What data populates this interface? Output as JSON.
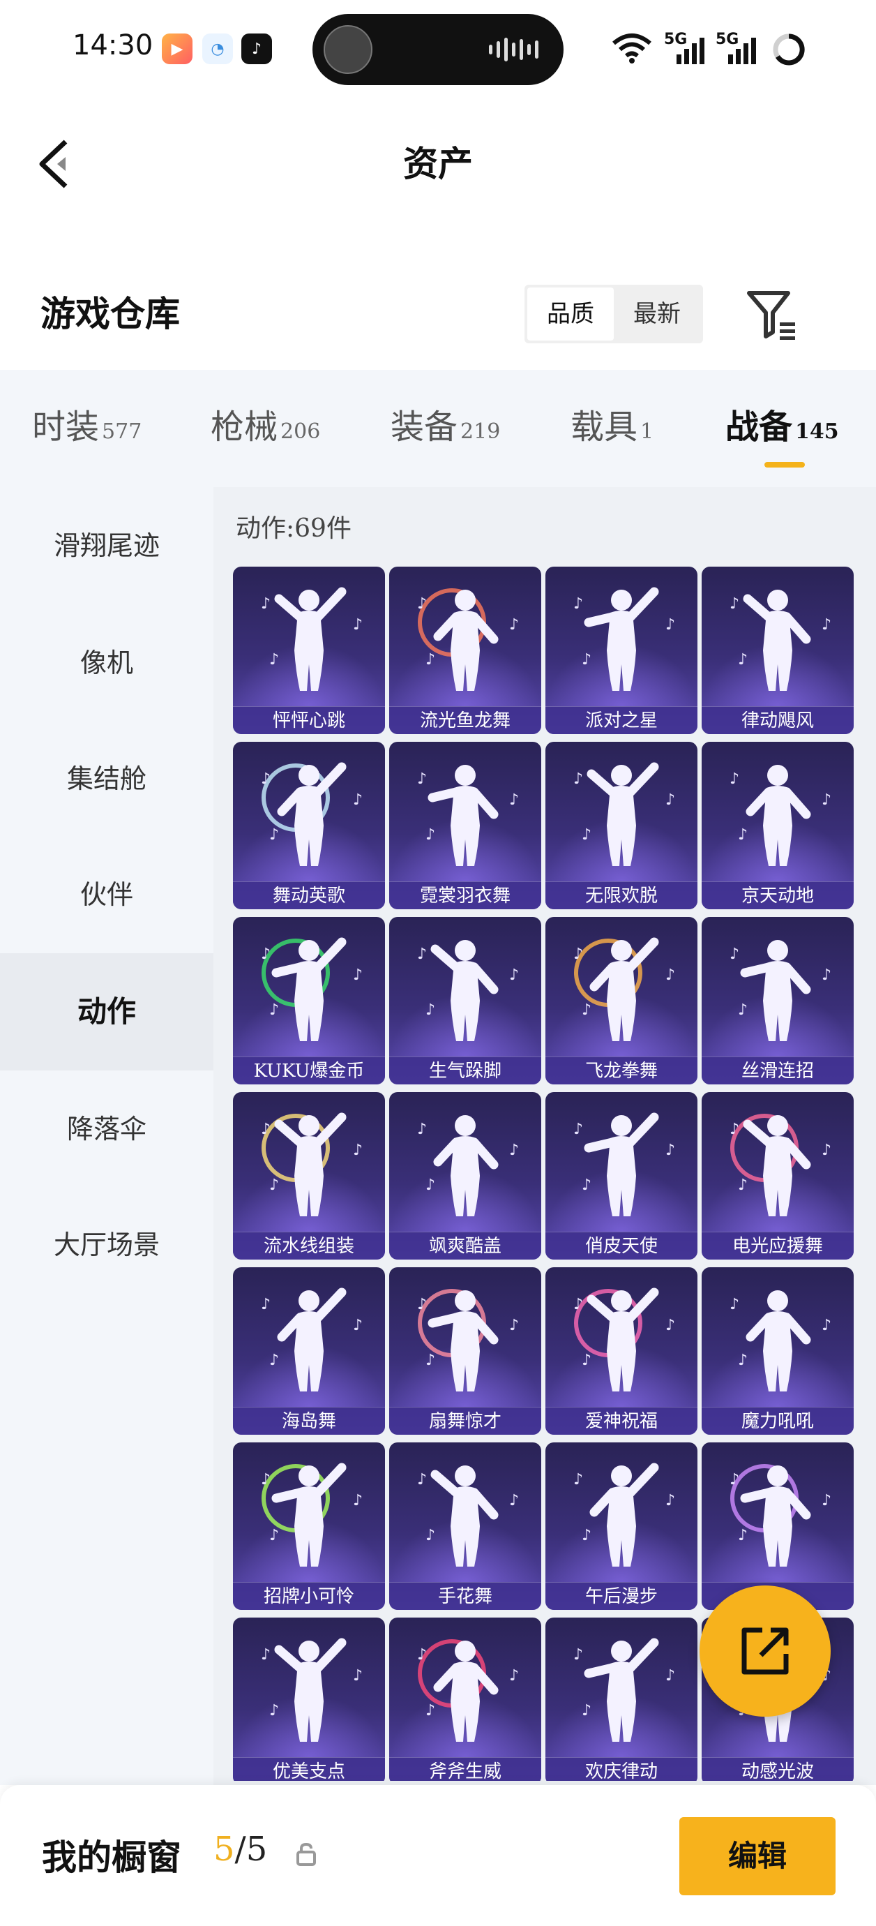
{
  "status_bar": {
    "time": "14:30",
    "network_1": "5G",
    "network_2": "5G"
  },
  "header": {
    "title": "资产",
    "back_icon": "back-arrow-icon"
  },
  "warehouse": {
    "title": "游戏仓库",
    "sort_options": [
      "品质",
      "最新"
    ],
    "filter_icon": "filter-icon"
  },
  "tabs": [
    {
      "label": "时装",
      "count": "577"
    },
    {
      "label": "枪械",
      "count": "206"
    },
    {
      "label": "装备",
      "count": "219"
    },
    {
      "label": "载具",
      "count": "1"
    },
    {
      "label": "战备",
      "count": "145"
    }
  ],
  "active_tab": "战备",
  "sidebar": {
    "items": [
      "滑翔尾迹",
      "像机",
      "集结舱",
      "伙伴",
      "动作",
      "降落伞",
      "大厅场景"
    ],
    "active": "动作"
  },
  "content": {
    "count_label": "动作:69件",
    "items": [
      "怦怦心跳",
      "流光鱼龙舞",
      "派对之星",
      "律动飓风",
      "舞动英歌",
      "霓裳羽衣舞",
      "无限欢脱",
      "京天动地",
      "KUKU爆金币",
      "生气跺脚",
      "飞龙拳舞",
      "丝滑连招",
      "流水线组装",
      "飒爽酷盖",
      "俏皮天使",
      "电光应援舞",
      "海岛舞",
      "扇舞惊才",
      "爱神祝福",
      "魔力吼吼",
      "招牌小可怜",
      "手花舞",
      "午后漫步",
      "",
      "优美支点",
      "斧斧生威",
      "欢庆律动",
      "动感光波"
    ]
  },
  "fab_icon": "share-icon",
  "bottom_bar": {
    "window_label": "我的橱窗",
    "window_current": "5",
    "window_total": "/5",
    "edit_label": "编辑"
  }
}
